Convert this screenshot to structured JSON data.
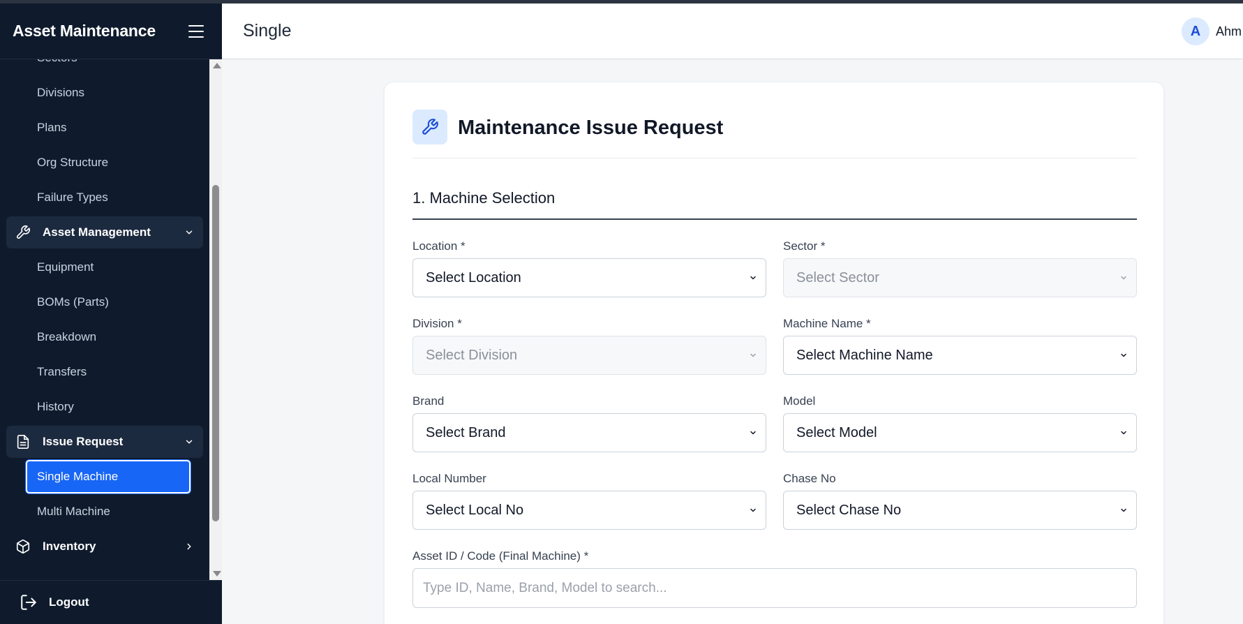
{
  "app": {
    "brand_title": "Asset Maintenance",
    "page_title": "Single",
    "user_initial": "A",
    "user_name": "Ahm"
  },
  "sidebar": {
    "items": [
      {
        "type": "sub",
        "label": "Sectors"
      },
      {
        "type": "sub",
        "label": "Divisions"
      },
      {
        "type": "sub",
        "label": "Plans"
      },
      {
        "type": "sub",
        "label": "Org Structure"
      },
      {
        "type": "sub",
        "label": "Failure Types"
      },
      {
        "type": "group",
        "label": "Asset Management",
        "icon": "wrench-icon",
        "expanded": true
      },
      {
        "type": "sub",
        "label": "Equipment"
      },
      {
        "type": "sub",
        "label": "BOMs (Parts)"
      },
      {
        "type": "sub",
        "label": "Breakdown"
      },
      {
        "type": "sub",
        "label": "Transfers"
      },
      {
        "type": "sub",
        "label": "History"
      },
      {
        "type": "group",
        "label": "Issue Request",
        "icon": "document-icon",
        "expanded": true
      },
      {
        "type": "sub",
        "label": "Single Machine",
        "active": true
      },
      {
        "type": "sub",
        "label": "Multi Machine"
      },
      {
        "type": "group",
        "label": "Inventory",
        "icon": "box-icon",
        "expanded": false
      }
    ],
    "logout_label": "Logout"
  },
  "form": {
    "title": "Maintenance Issue Request",
    "section_title": "1. Machine Selection",
    "location": {
      "label": "Location *",
      "value": "Select Location"
    },
    "sector": {
      "label": "Sector *",
      "value": "Select Sector",
      "disabled": true
    },
    "division": {
      "label": "Division *",
      "value": "Select Division",
      "disabled": true
    },
    "machine_name": {
      "label": "Machine Name *",
      "value": "Select Machine Name"
    },
    "brand": {
      "label": "Brand",
      "value": "Select Brand"
    },
    "model": {
      "label": "Model",
      "value": "Select Model"
    },
    "local_number": {
      "label": "Local Number",
      "value": "Select Local No"
    },
    "chase_no": {
      "label": "Chase No",
      "value": "Select Chase No"
    },
    "asset_id": {
      "label": "Asset ID / Code (Final Machine) *",
      "placeholder": "Type ID, Name, Brand, Model to search..."
    }
  },
  "colors": {
    "sidebar_bg": "#0f1b2d",
    "active_item": "#1866f5",
    "accent": "#1d4ed8"
  }
}
